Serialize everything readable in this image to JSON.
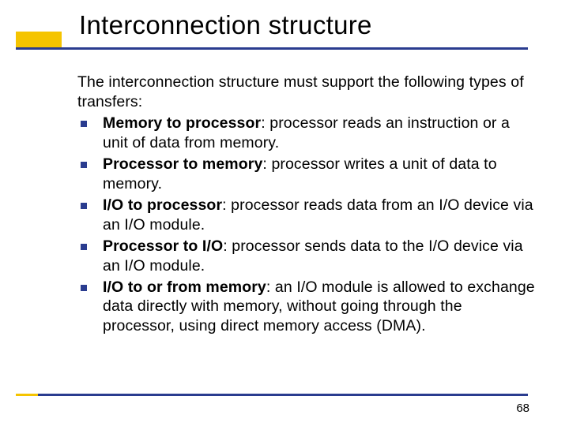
{
  "title": "Interconnection structure",
  "intro": "The interconnection structure must support the following types of transfers:",
  "items": [
    {
      "bold": "Memory to processor",
      "rest": ": processor reads an instruction or a unit of data from memory."
    },
    {
      "bold": " Processor to memory",
      "rest": ": processor writes a unit of data to memory."
    },
    {
      "bold": "I/O to processor",
      "rest": ": processor reads data from an I/O device via an I/O module."
    },
    {
      "bold": "Processor to I/O",
      "rest": ": processor sends data to the I/O device via an I/O module."
    },
    {
      "bold": "I/O to or from memory",
      "rest": ": an I/O module is allowed to exchange data directly with memory, without going through the processor, using direct memory access (DMA)."
    }
  ],
  "page_number": "68"
}
